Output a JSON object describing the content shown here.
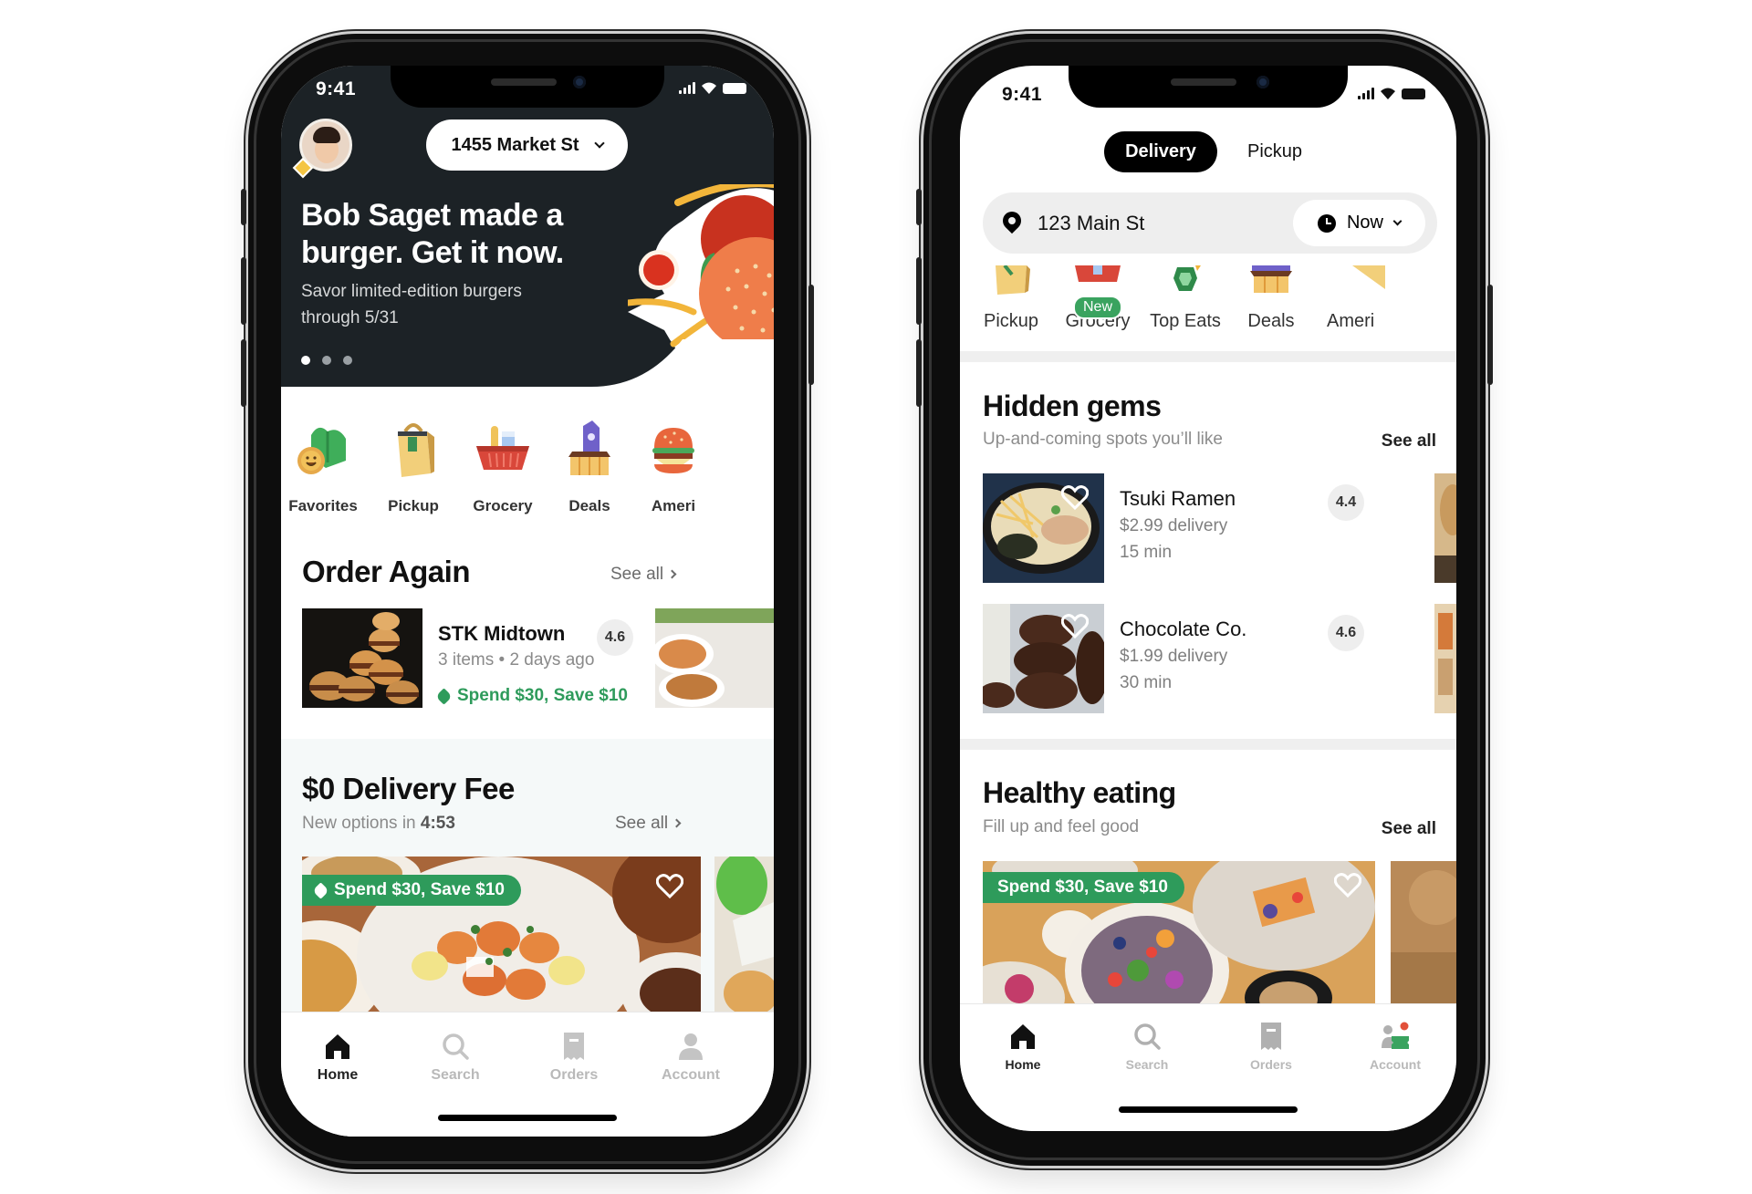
{
  "left_phone": {
    "status": {
      "time": "9:41"
    },
    "header": {
      "address": "1455 Market St"
    },
    "hero": {
      "title": "Bob Saget made a burger. Get it now.",
      "subtitle": "Savor limited-edition burgers through 5/31",
      "carousel_pages": 3,
      "carousel_active": 1
    },
    "categories": [
      {
        "label": "Favorites",
        "icon": "favorites-icon"
      },
      {
        "label": "Pickup",
        "icon": "shopping-bag-icon"
      },
      {
        "label": "Grocery",
        "icon": "grocery-basket-icon"
      },
      {
        "label": "Deals",
        "icon": "deals-tag-icon"
      },
      {
        "label": "Ameri",
        "icon": "burger-icon"
      }
    ],
    "order_again": {
      "title": "Order Again",
      "see_all": "See all",
      "items": [
        {
          "name": "STK Midtown",
          "meta": "3 items • 2 days ago",
          "promo": "Spend $30, Save $10",
          "rating": "4.6"
        }
      ]
    },
    "delivery_fee": {
      "title": "$0 Delivery Fee",
      "subtitle_prefix": "New options in ",
      "countdown": "4:53",
      "see_all": "See all",
      "card": {
        "promo": "Spend $30, Save $10"
      }
    },
    "tabbar": [
      {
        "label": "Home",
        "icon": "home-icon",
        "active": true
      },
      {
        "label": "Search",
        "icon": "search-icon",
        "active": false
      },
      {
        "label": "Orders",
        "icon": "receipt-icon",
        "active": false
      },
      {
        "label": "Account",
        "icon": "person-icon",
        "active": false
      }
    ]
  },
  "right_phone": {
    "status": {
      "time": "9:41"
    },
    "mode_toggle": {
      "selected": "Delivery",
      "other": "Pickup"
    },
    "address_bar": {
      "address": "123 Main St",
      "time_option": "Now"
    },
    "categories": [
      {
        "label": "Pickup",
        "icon": "shopping-bag-icon"
      },
      {
        "label": "Grocery",
        "icon": "grocery-basket-icon",
        "badge": "New"
      },
      {
        "label": "Top Eats",
        "icon": "top-eats-icon"
      },
      {
        "label": "Deals",
        "icon": "deals-tag-icon"
      },
      {
        "label": "Ameri",
        "icon": "burger-icon"
      }
    ],
    "hidden_gems": {
      "title": "Hidden gems",
      "subtitle": "Up-and-coming spots you’ll like",
      "see_all": "See all",
      "items": [
        {
          "name": "Tsuki Ramen",
          "fee": "$2.99 delivery",
          "eta": "15 min",
          "rating": "4.4"
        },
        {
          "name": "Chocolate Co.",
          "fee": "$1.99 delivery",
          "eta": "30 min",
          "rating": "4.6"
        }
      ]
    },
    "healthy_eating": {
      "title": "Healthy eating",
      "subtitle": "Fill up and feel good",
      "see_all": "See all",
      "card": {
        "promo": "Spend $30, Save $10"
      }
    },
    "tabbar": [
      {
        "label": "Home",
        "icon": "home-icon",
        "active": true
      },
      {
        "label": "Search",
        "icon": "search-icon",
        "active": false
      },
      {
        "label": "Orders",
        "icon": "receipt-icon",
        "active": false
      },
      {
        "label": "Account",
        "icon": "account-notification-icon",
        "active": false
      }
    ]
  },
  "colors": {
    "brand_green": "#2e9b5b",
    "hero_dark": "#1c2226",
    "inactive_tab": "#b9b9b9"
  }
}
